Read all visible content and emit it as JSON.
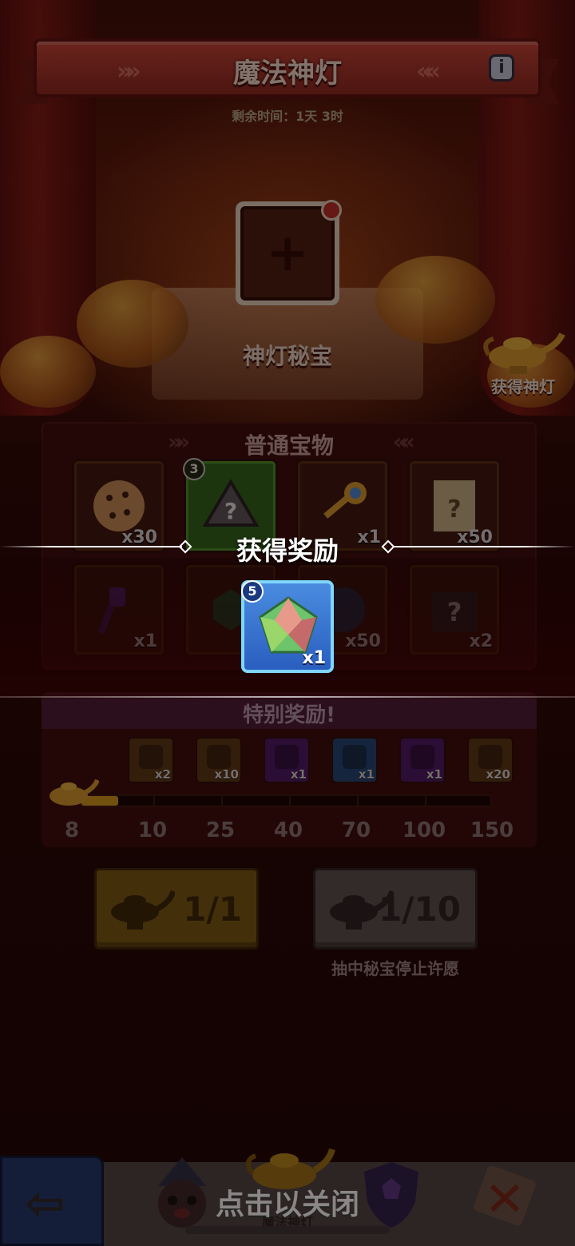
{
  "header": {
    "title": "魔法神灯",
    "timer": "剩余时间：1天 3时"
  },
  "slot": {
    "caption": "神灯秘宝"
  },
  "side": {
    "get_lamp_label": "获得神灯"
  },
  "normal": {
    "title": "普通宝物",
    "items": [
      {
        "icon": "cookie-icon",
        "qty": "x30",
        "level": ""
      },
      {
        "icon": "mystery-stone-icon",
        "qty": "",
        "level": "3"
      },
      {
        "icon": "key-icon",
        "qty": "x1",
        "level": ""
      },
      {
        "icon": "mystery-scroll-icon",
        "qty": "x50",
        "level": ""
      },
      {
        "icon": "purple-key-icon",
        "qty": "x1",
        "level": ""
      },
      {
        "icon": "green-gem-icon",
        "qty": "",
        "level": ""
      },
      {
        "icon": "blue-token-icon",
        "qty": "x50",
        "level": ""
      },
      {
        "icon": "mystery-puzzle-icon",
        "qty": "x2",
        "level": ""
      }
    ]
  },
  "special": {
    "title": "特别奖励!",
    "rewards": [
      {
        "icon": "purple-key-icon",
        "qty": "x2",
        "color": "#5a3a16"
      },
      {
        "icon": "mystery-puzzle-icon",
        "qty": "x10",
        "color": "#5a3a16"
      },
      {
        "icon": "mystery-ring-icon",
        "qty": "x1",
        "color": "#4a1a6a"
      },
      {
        "icon": "mystery-stone-icon",
        "qty": "x1",
        "color": "#1e4a7a"
      },
      {
        "icon": "mystery-card-icon",
        "qty": "x1",
        "color": "#4a1a6a"
      },
      {
        "icon": "cat-hero-icon",
        "qty": "x20",
        "color": "#5a3a16"
      }
    ],
    "milestones": [
      "8",
      "10",
      "25",
      "40",
      "70",
      "100",
      "150"
    ],
    "progress": 0.09
  },
  "buttons": {
    "single": "1/1",
    "ten": "1/10",
    "stop_note": "抽中秘宝停止许愿"
  },
  "overlay": {
    "title": "获得奖励",
    "reward": {
      "icon": "gem-icon",
      "qty": "x1",
      "level": "5"
    },
    "close_hint": "点击以关闭"
  },
  "nav": {
    "active_label": "魔法神灯"
  },
  "colors": {
    "gold": "#d8a020",
    "banner": "#c8483a",
    "reward_card": "#2a5ec0"
  }
}
